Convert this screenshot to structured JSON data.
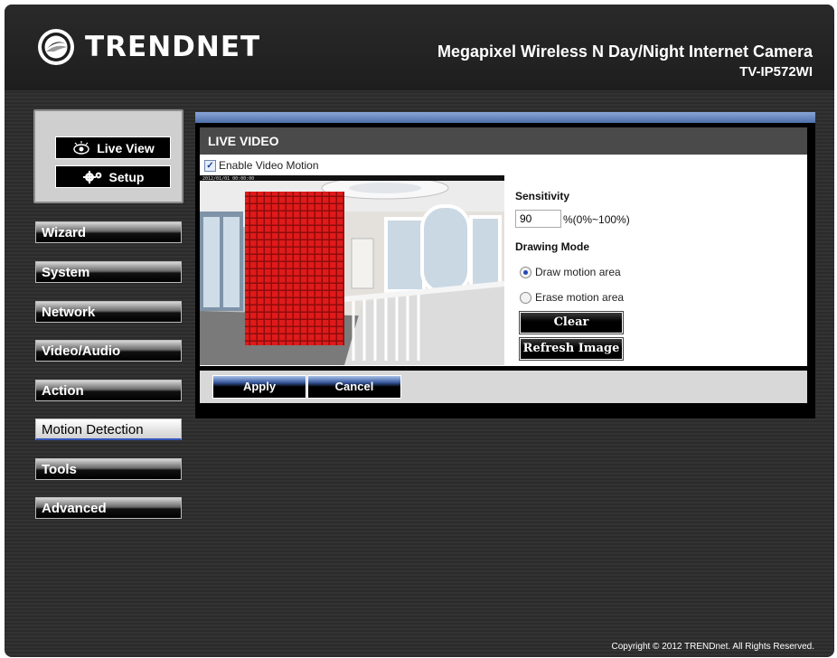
{
  "header": {
    "logo_text": "TRENDNET",
    "product_title": "Megapixel Wireless N Day/Night Internet Camera",
    "model": "TV-IP572WI"
  },
  "top_buttons": {
    "live_view": "Live View",
    "setup": "Setup"
  },
  "nav": {
    "items": [
      {
        "label": "Wizard"
      },
      {
        "label": "System"
      },
      {
        "label": "Network"
      },
      {
        "label": "Video/Audio"
      },
      {
        "label": "Action"
      },
      {
        "label": "Motion Detection",
        "active": true
      },
      {
        "label": "Tools"
      },
      {
        "label": "Advanced"
      }
    ]
  },
  "panel": {
    "title": "LIVE VIDEO",
    "enable_label": "Enable Video Motion",
    "enable_checked": true,
    "sensitivity_label": "Sensitivity",
    "sensitivity_value": "90",
    "sensitivity_range": "%(0%~100%)",
    "drawing_mode_label": "Drawing Mode",
    "draw_option": "Draw motion area",
    "erase_option": "Erase motion area",
    "selected_mode": "Draw motion area",
    "clear_label": "Clear",
    "refresh_label": "Refresh Image"
  },
  "actions": {
    "apply": "Apply",
    "cancel": "Cancel"
  },
  "footer": {
    "copyright": "Copyright © 2012 TRENDnet. All Rights Reserved."
  },
  "colors": {
    "accent_blue": "#4e6fa8",
    "motion_red": "#e01a1a"
  }
}
